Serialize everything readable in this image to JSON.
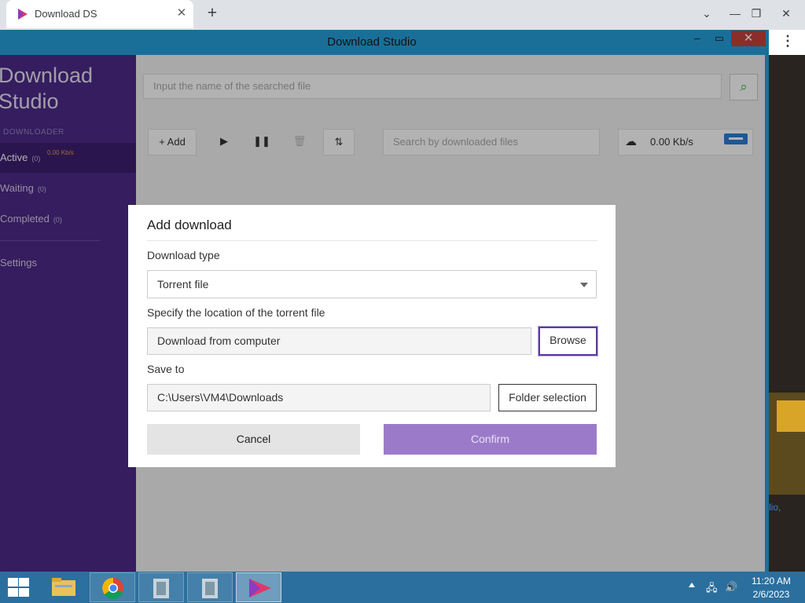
{
  "browser": {
    "tab_title": "Download DS",
    "new_tab_icon": "plus",
    "controls": [
      "chevron-down",
      "minimize",
      "restore",
      "close"
    ]
  },
  "window": {
    "title": "Download Studio"
  },
  "sidebar": {
    "brand_line1": "Download",
    "brand_line2": "Studio",
    "section_label": "DOWNLOADER",
    "items": [
      {
        "label": "Active",
        "count": "(0)",
        "speed": "0.00 Kb/s"
      },
      {
        "label": "Waiting",
        "count": "(0)"
      },
      {
        "label": "Completed",
        "count": "(0)"
      },
      {
        "label": "Settings"
      }
    ]
  },
  "main": {
    "search_placeholder": "Input the name of the searched file",
    "add_label": "+ Add",
    "downloads_search_placeholder": "Search by downloaded files",
    "speed": "0.00 Kb/s"
  },
  "dialog": {
    "title": "Add download",
    "download_type_label": "Download type",
    "download_type_value": "Torrent file",
    "location_label": "Specify the location of the torrent file",
    "location_value": "Download from computer",
    "browse_label": "Browse",
    "save_to_label": "Save to",
    "save_to_value": "C:\\Users\\VM4\\Downloads",
    "folder_selection_label": "Folder selection",
    "cancel_label": "Cancel",
    "confirm_label": "Confirm"
  },
  "page_behind": {
    "link_text": "lio,"
  },
  "taskbar": {
    "time": "11:20 AM",
    "date": "2/6/2023"
  },
  "colors": {
    "sidebar": "#4d2a88",
    "accent": "#9b7bc9",
    "titlebar": "#26a0da",
    "taskbar": "#2b6f9e"
  }
}
